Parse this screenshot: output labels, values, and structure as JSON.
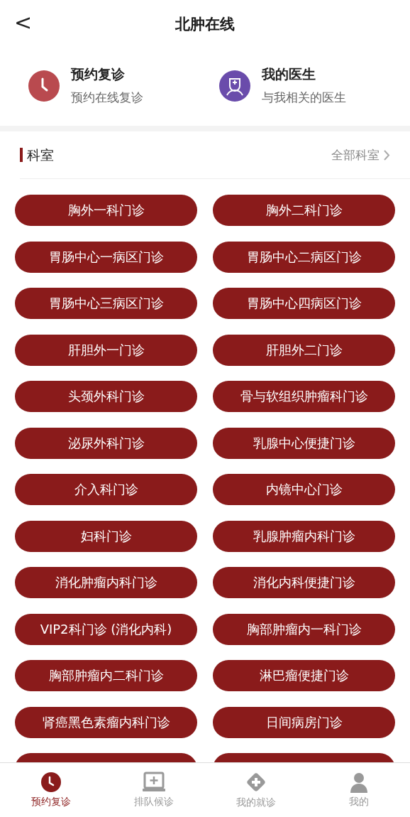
{
  "header": {
    "back": "<",
    "title": "北肿在线"
  },
  "quick_actions": [
    {
      "kind": "clock",
      "title": "预约复诊",
      "subtitle": "预约在线复诊",
      "color": "#b94a4f"
    },
    {
      "kind": "doctor",
      "title": "我的医生",
      "subtitle": "与我相关的医生",
      "color": "#6a4cab"
    }
  ],
  "section": {
    "title": "科室",
    "link": "全部科室"
  },
  "departments": [
    {
      "kind": "department",
      "label": "胸外一科门诊"
    },
    {
      "kind": "department",
      "label": "胸外二科门诊"
    },
    {
      "kind": "department",
      "label": "胃肠中心一病区门诊"
    },
    {
      "kind": "department",
      "label": "胃肠中心二病区门诊"
    },
    {
      "kind": "department",
      "label": "胃肠中心三病区门诊"
    },
    {
      "kind": "department",
      "label": "胃肠中心四病区门诊"
    },
    {
      "kind": "department",
      "label": "肝胆外一门诊"
    },
    {
      "kind": "department",
      "label": "肝胆外二门诊"
    },
    {
      "kind": "department",
      "label": "头颈外科门诊"
    },
    {
      "kind": "department",
      "label": "骨与软组织肿瘤科门诊"
    },
    {
      "kind": "department",
      "label": "泌尿外科门诊"
    },
    {
      "kind": "department",
      "label": "乳腺中心便捷门诊"
    },
    {
      "kind": "department",
      "label": "介入科门诊"
    },
    {
      "kind": "department",
      "label": "内镜中心门诊"
    },
    {
      "kind": "department",
      "label": "妇科门诊"
    },
    {
      "kind": "department",
      "label": "乳腺肿瘤内科门诊"
    },
    {
      "kind": "department",
      "label": "消化肿瘤内科门诊"
    },
    {
      "kind": "department",
      "label": "消化内科便捷门诊"
    },
    {
      "kind": "department",
      "label": "VIP2科门诊 (消化内科)"
    },
    {
      "kind": "department",
      "label": "胸部肿瘤内一科门诊"
    },
    {
      "kind": "department",
      "label": "胸部肿瘤内二科门诊"
    },
    {
      "kind": "department",
      "label": "淋巴瘤便捷门诊"
    },
    {
      "kind": "department",
      "label": "肾癌黑色素瘤内科门诊"
    },
    {
      "kind": "department",
      "label": "日间病房门诊"
    },
    {
      "kind": "cut"
    },
    {
      "kind": "cut"
    }
  ],
  "tab_bar": [
    {
      "kind": "clock",
      "label": "预约复诊",
      "selected": true
    },
    {
      "kind": "monitor",
      "label": "排队候诊",
      "selected": false
    },
    {
      "kind": "diamond",
      "label": "我的就诊",
      "selected": false
    },
    {
      "kind": "person",
      "label": "我的",
      "selected": false
    }
  ]
}
